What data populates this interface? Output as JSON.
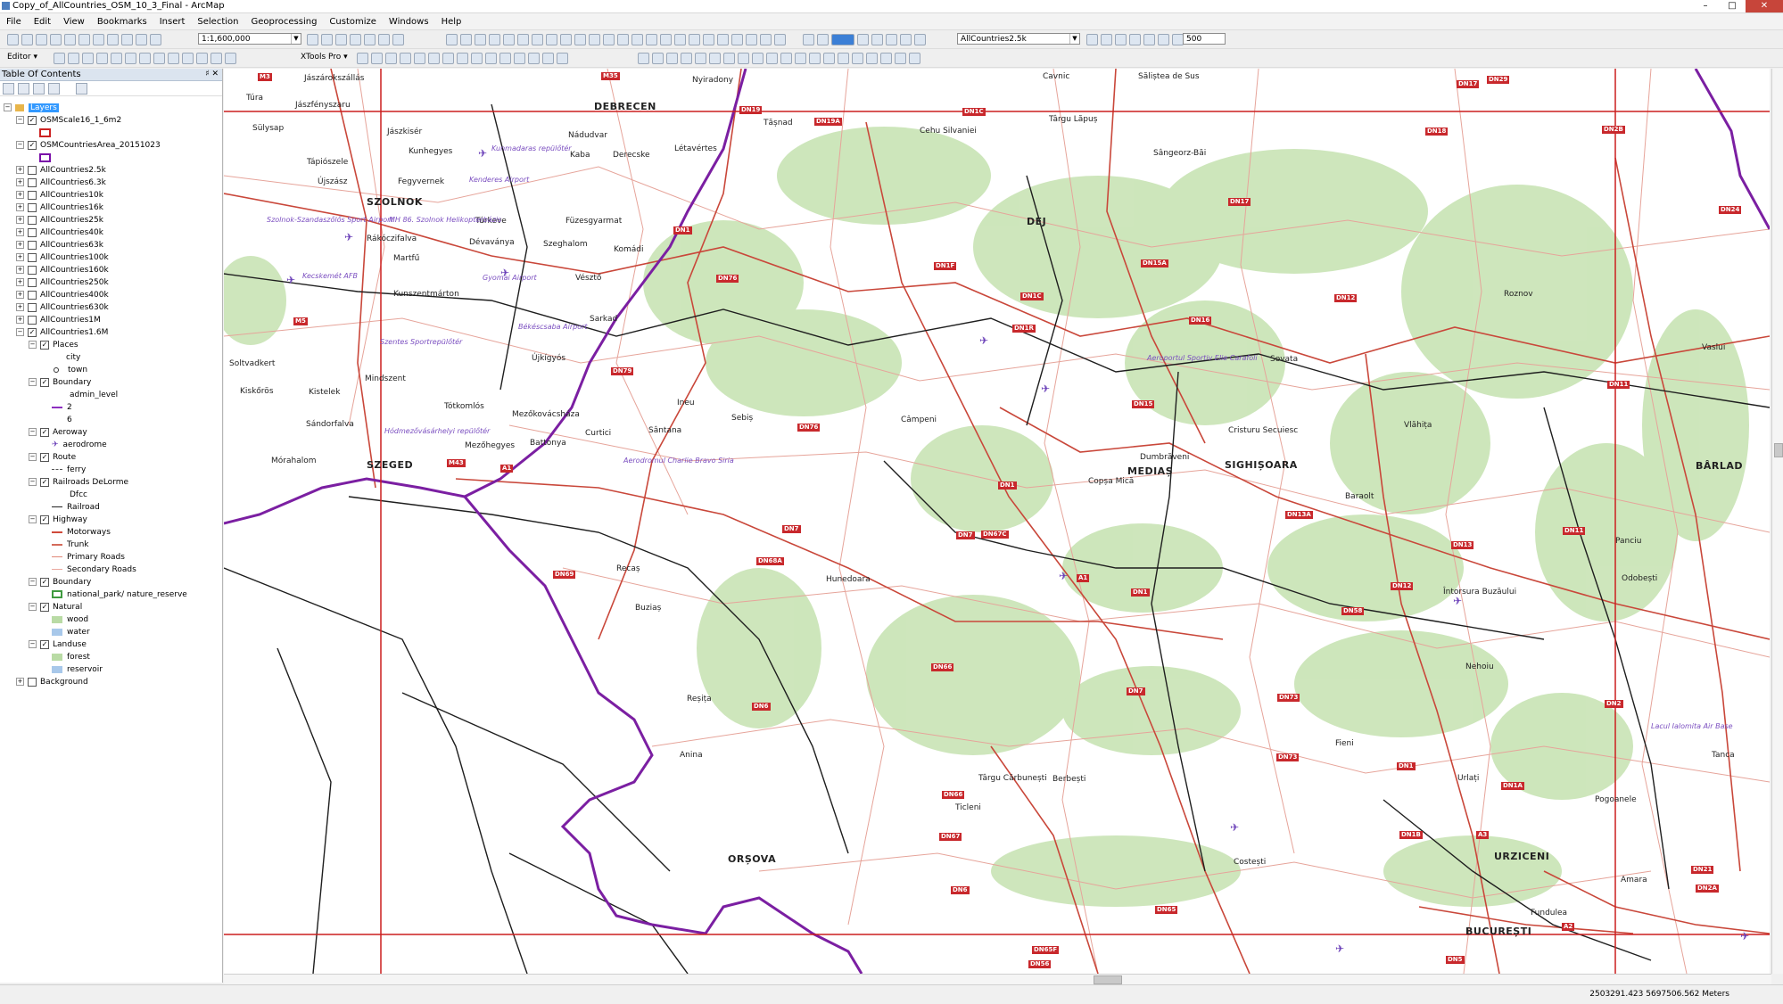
{
  "window": {
    "title": "Copy_of_AllCountries_OSM_10_3_Final - ArcMap"
  },
  "menu": [
    "File",
    "Edit",
    "View",
    "Bookmarks",
    "Insert",
    "Selection",
    "Geoprocessing",
    "Customize",
    "Windows",
    "Help"
  ],
  "toolbar": {
    "scale": "1:1,600,000",
    "layer_combo": "AllCountries2.5k",
    "number_value": "500",
    "editor_label": "Editor ▾",
    "xtools_label": "XTools Pro ▾"
  },
  "toc": {
    "title": "Table Of Contents",
    "root": "Layers",
    "items": [
      {
        "label": "OSMScale16_1_6m2",
        "checked": true,
        "expanded": true
      },
      {
        "label": "OSMCountriesArea_20151023",
        "checked": true,
        "expanded": true
      },
      {
        "label": "AllCountries2.5k"
      },
      {
        "label": "AllCountries6.3k"
      },
      {
        "label": "AllCountries10k"
      },
      {
        "label": "AllCountries16k"
      },
      {
        "label": "AllCountries25k"
      },
      {
        "label": "AllCountries40k"
      },
      {
        "label": "AllCountries63k"
      },
      {
        "label": "AllCountries100k"
      },
      {
        "label": "AllCountries160k"
      },
      {
        "label": "AllCountries250k"
      },
      {
        "label": "AllCountries400k"
      },
      {
        "label": "AllCountries630k"
      },
      {
        "label": "AllCountries1M"
      },
      {
        "label": "AllCountries1.6M",
        "checked": true,
        "expanded": true
      }
    ],
    "sub": {
      "places": "Places",
      "city": "city",
      "town": "town",
      "boundary": "Boundary",
      "admin_level": "admin_level",
      "lvl2": "2",
      "lvl6": "6",
      "aeroway": "Aeroway",
      "aerodrome": "aerodrome",
      "route": "Route",
      "ferry": "ferry",
      "railroads": "Railroads DeLorme",
      "dfcc": "Dfcc",
      "railroad": "Railroad",
      "highway": "Highway",
      "motorways": "Motorways",
      "trunk": "Trunk",
      "primary": "Primary Roads",
      "secondary": "Secondary Roads",
      "boundary2": "Boundary",
      "national_park": "national_park/ nature_reserve",
      "natural": "Natural",
      "wood": "wood",
      "water": "water",
      "landuse": "Landuse",
      "forest": "forest",
      "reservoir": "reservoir",
      "background": "Background"
    }
  },
  "map": {
    "cities_big": [
      "DEBRECEN",
      "SZOLNOK",
      "SZEGED",
      "DEJ",
      "MEDIAȘ",
      "SIGHIȘOARA",
      "ORȘOVA",
      "URZICENI",
      "BÂRLAD",
      "BUCUREȘTI"
    ],
    "towns": [
      "Túra",
      "Jászárokszállás",
      "Nyiradony",
      "Cavnic",
      "Săliștea de Sus",
      "Jászfényszaru",
      "Sülysap",
      "Jászkisér",
      "Tășnad",
      "Târgu Lăpuș",
      "Cehu Silvaniei",
      "Kunhegyes",
      "Kaba",
      "Nádudvar",
      "Derecske",
      "Létavértes",
      "Sângeorz-Băi",
      "Tápiószele",
      "Újszász",
      "Fegyvernek",
      "Túrkeve",
      "Füzesgyarmat",
      "Rákóczifalva",
      "Dévaványa",
      "Szeghalom",
      "Komádi",
      "Martfű",
      "Vésztő",
      "Kunszentmárton",
      "Sarkad",
      "Roznov",
      "Solt​vadkert",
      "Újkígyós",
      "Sovata",
      "Vaslui",
      "Kiskőrös",
      "Mindszent",
      "Kistelek",
      "Tótkomlós",
      "Mezőkovácsháza",
      "Ineu",
      "Sebiș",
      "Câmpeni",
      "Cristuru Secuiesc",
      "Vlăhița",
      "Sándorfalva",
      "Mezőhegyes",
      "Battonya",
      "Curtici",
      "Sântana",
      "Dumbrăveni",
      "Copșa Mică",
      "Baraolt",
      "Mórahalom",
      "Panciu",
      "Recaș",
      "Hunedoara",
      "Buziaș",
      "Întorsura Buzăului",
      "Odobești",
      "Nehoiu",
      "Reșița",
      "Anina",
      "Fieni",
      "Tanca",
      "Târgu Cărbunești",
      "Berbești",
      "Urlați",
      "Pogoanele",
      "Ticleni",
      "Costești",
      "Amara",
      "Fundulea"
    ],
    "airports": [
      "Kunmadaras repülőtér",
      "Kenderes Airport",
      "Szolnok-Szandaszőlős Sport Airport",
      "MH 86. Szolnok Helikopterbázis",
      "Kecskemét AFB",
      "Gyomai Airport",
      "Békéscsaba Airport",
      "Szentes Sportrepülőtér",
      "Hódmezővásárhelyi repülőtér",
      "Aerodromul Charlie Bravo Siria",
      "Aeroportul Sportiv Elie Carafoli",
      "Lacul Ialomita Air Base"
    ],
    "roads": [
      "M3",
      "M35",
      "DN19",
      "DN1C",
      "DN19A",
      "DN18",
      "DN17",
      "DN29",
      "DN1",
      "DN1F",
      "DN1C",
      "DN1R",
      "DN17",
      "DN15A",
      "DN16",
      "DN12",
      "DN2B",
      "DN24",
      "DN76",
      "DN79",
      "DN76",
      "DN15",
      "DN11",
      "DN13A",
      "DN1",
      "DN7",
      "DN68A",
      "DN67C",
      "DN7",
      "A1",
      "DN13",
      "DN11",
      "DN12",
      "DN1",
      "DN69",
      "DN6",
      "DN58",
      "DN66",
      "DN73",
      "DN7",
      "DN1",
      "DN2",
      "DN1A",
      "DN67",
      "DN65",
      "DN6",
      "DN65F",
      "DN56",
      "DN5",
      "DN21",
      "DN2A",
      "A3",
      "DN1B",
      "M43",
      "A1",
      "M5",
      "DN73",
      "A2",
      "DN66"
    ]
  },
  "status": {
    "coords": "2503291.423  5697506.562 Meters"
  }
}
